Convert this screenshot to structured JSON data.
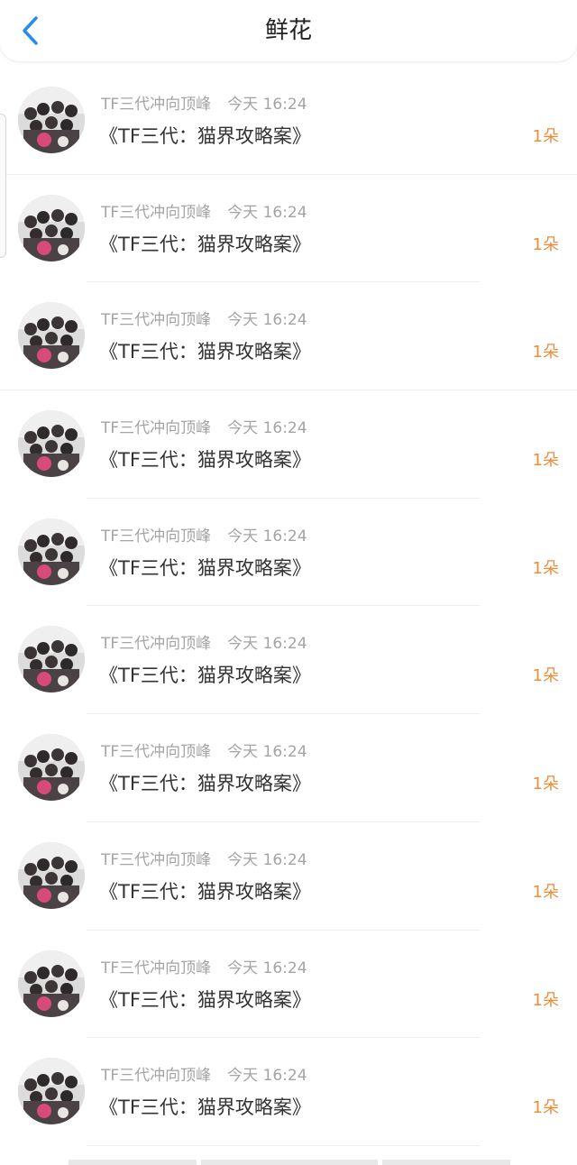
{
  "header": {
    "title": "鲜花"
  },
  "colors": {
    "accent": "#2a8be8",
    "count": "#ef8c38",
    "meta": "#a4a4a4",
    "text": "#333333"
  },
  "list": {
    "items": [
      {
        "author": "TF三代冲向顶峰",
        "time": "今天 16:24",
        "book": "《TF三代：猫界攻略案》",
        "count": "1朵"
      },
      {
        "author": "TF三代冲向顶峰",
        "time": "今天 16:24",
        "book": "《TF三代：猫界攻略案》",
        "count": "1朵"
      },
      {
        "author": "TF三代冲向顶峰",
        "time": "今天 16:24",
        "book": "《TF三代：猫界攻略案》",
        "count": "1朵"
      },
      {
        "author": "TF三代冲向顶峰",
        "time": "今天 16:24",
        "book": "《TF三代：猫界攻略案》",
        "count": "1朵"
      },
      {
        "author": "TF三代冲向顶峰",
        "time": "今天 16:24",
        "book": "《TF三代：猫界攻略案》",
        "count": "1朵"
      },
      {
        "author": "TF三代冲向顶峰",
        "time": "今天 16:24",
        "book": "《TF三代：猫界攻略案》",
        "count": "1朵"
      },
      {
        "author": "TF三代冲向顶峰",
        "time": "今天 16:24",
        "book": "《TF三代：猫界攻略案》",
        "count": "1朵"
      },
      {
        "author": "TF三代冲向顶峰",
        "time": "今天 16:24",
        "book": "《TF三代：猫界攻略案》",
        "count": "1朵"
      },
      {
        "author": "TF三代冲向顶峰",
        "time": "今天 16:24",
        "book": "《TF三代：猫界攻略案》",
        "count": "1朵"
      },
      {
        "author": "TF三代冲向顶峰",
        "time": "今天 16:24",
        "book": "《TF三代：猫界攻略案》",
        "count": "1朵"
      }
    ]
  }
}
